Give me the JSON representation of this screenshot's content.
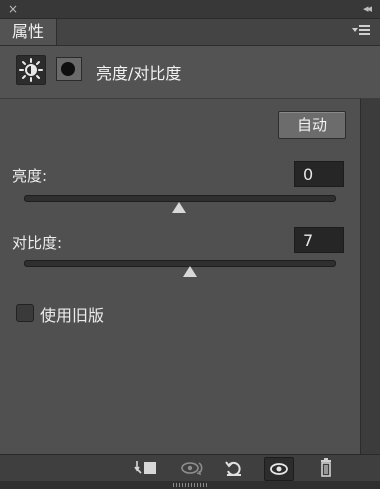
{
  "header": {
    "close": "×",
    "collapse": "◂◂",
    "tab_label": "属性"
  },
  "adjustment": {
    "title": "亮度/对比度"
  },
  "controls": {
    "auto_label": "自动",
    "brightness": {
      "label": "亮度:",
      "value": "0",
      "slider_fraction": 0.5
    },
    "contrast": {
      "label": "对比度:",
      "value": "7",
      "slider_fraction": 0.535
    },
    "legacy": {
      "label": "使用旧版",
      "checked": false
    }
  },
  "toolbar": {
    "icons": [
      "clip-to-layer-icon",
      "view-previous-state-icon",
      "reset-icon",
      "visibility-eye-icon",
      "trash-icon"
    ]
  }
}
